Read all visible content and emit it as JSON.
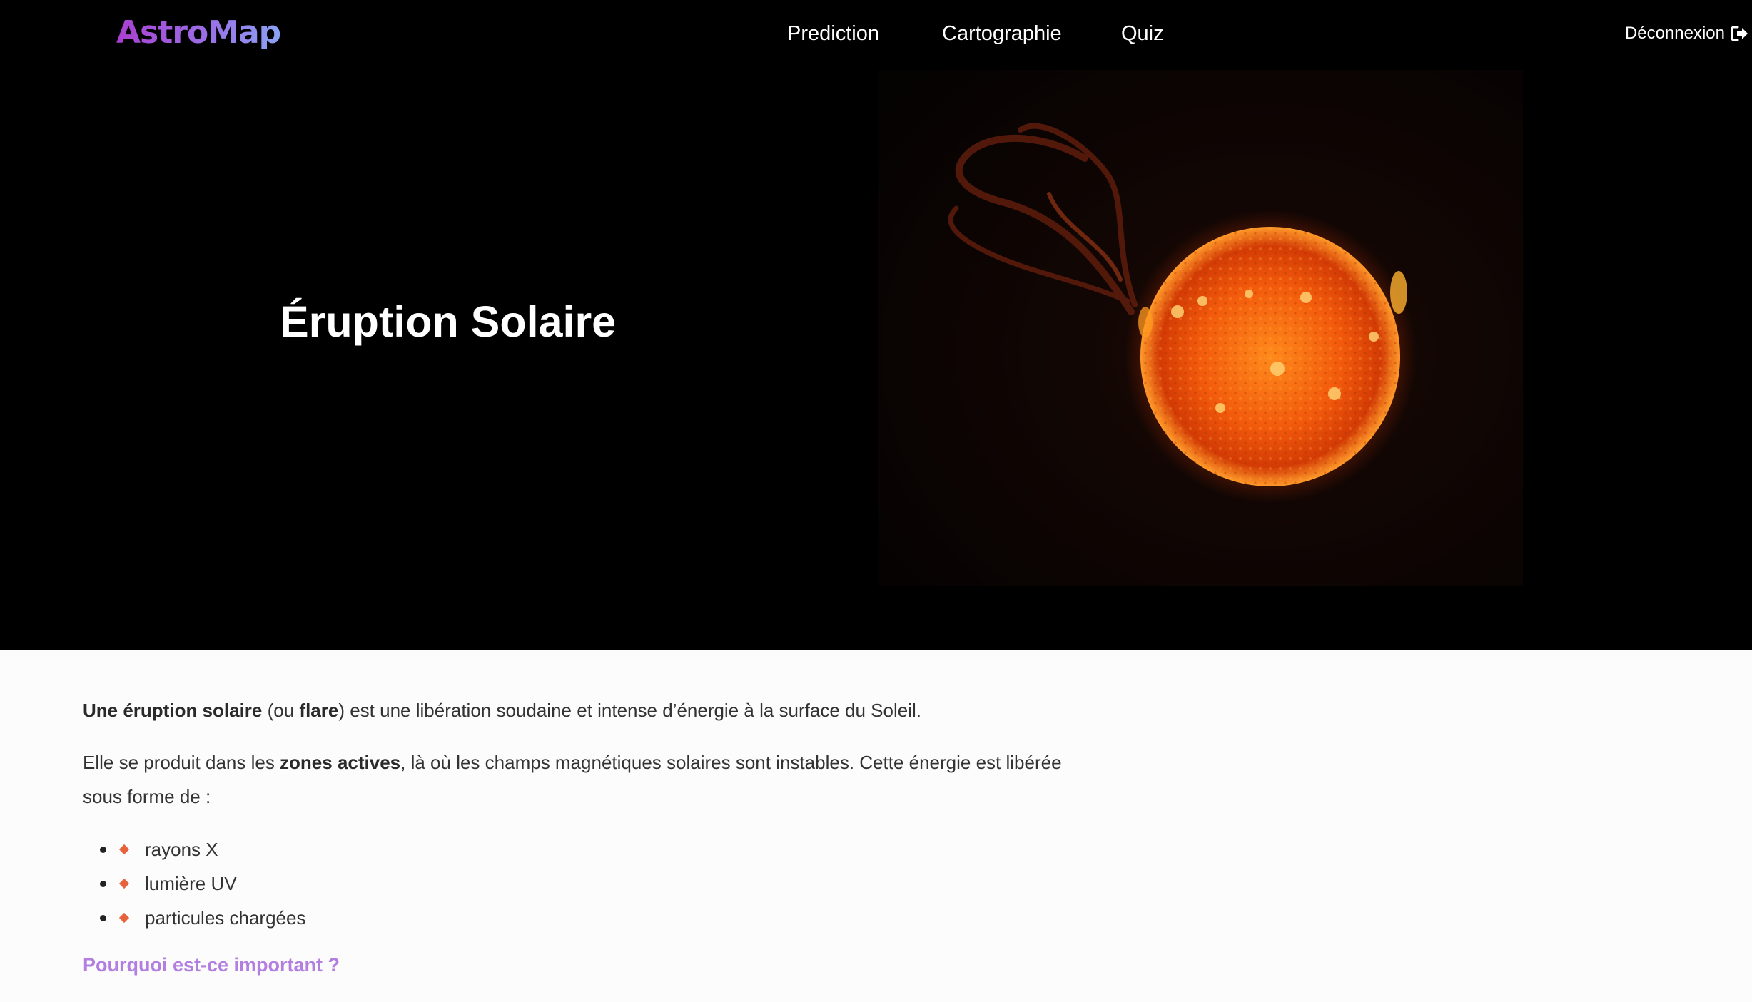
{
  "nav": {
    "logo": "AstroMap",
    "links": [
      "Prediction",
      "Cartographie",
      "Quiz"
    ],
    "logout_label": "Déconnexion",
    "logout_icon": "sign-out-icon"
  },
  "hero": {
    "title": "Éruption Solaire",
    "image_subject": "solar-flare-sun-image"
  },
  "content": {
    "p1": {
      "b1": "Une éruption solaire",
      "t1": " (ou ",
      "b2": "flare",
      "t2": ") est une libération soudaine et intense d’énergie à la surface du Soleil."
    },
    "p2": {
      "t1": "Elle se produit dans les ",
      "b1": "zones actives",
      "t2": ", là où les champs magnétiques solaires sont instables. Cette énergie est libérée sous forme de :"
    },
    "list": [
      "rayons X",
      "lumière UV",
      "particules chargées"
    ],
    "section_heading": "Pourquoi est-ce important ?"
  },
  "colors": {
    "accent_purple": "#b27fe0",
    "bullet_orange": "#e8613d",
    "hero_background": "#000000",
    "content_background": "#fcfcfc"
  }
}
